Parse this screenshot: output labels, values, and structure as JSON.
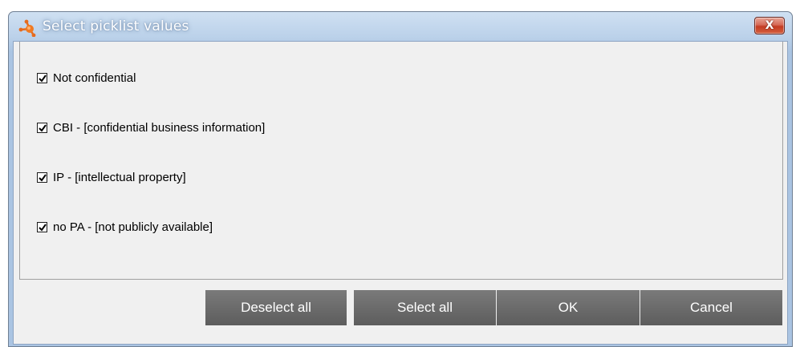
{
  "window": {
    "title": "Select picklist values",
    "close_label": "X"
  },
  "options": [
    {
      "label": "Not confidential",
      "checked": true
    },
    {
      "label": "CBI - [confidential business information]",
      "checked": true
    },
    {
      "label": "IP - [intellectual property]",
      "checked": true
    },
    {
      "label": "no PA - [not publicly available]",
      "checked": true
    }
  ],
  "buttons": {
    "deselect_all": "Deselect all",
    "select_all": "Select all",
    "ok": "OK",
    "cancel": "Cancel"
  },
  "colors": {
    "titlebar": "#aac4e2",
    "button_bg": "#666666",
    "panel_bg": "#f0f0f0",
    "close_button": "#c43b22"
  },
  "icons": {
    "app": "app-logo-icon",
    "close": "close-icon",
    "check": "checkmark-icon"
  }
}
